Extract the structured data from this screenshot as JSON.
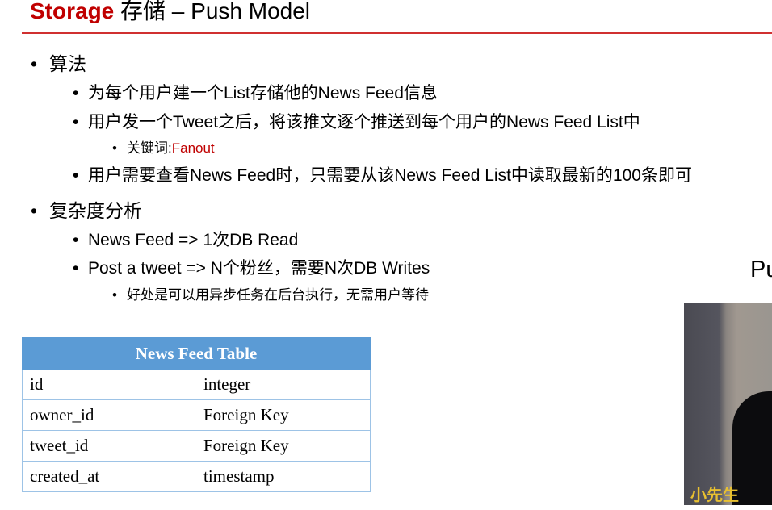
{
  "title": {
    "highlight": "Storage",
    "rest": " 存储 – Push Model"
  },
  "sections": [
    {
      "heading": "算法",
      "items": [
        {
          "text": "为每个用户建一个List存储他的News Feed信息"
        },
        {
          "text": "用户发一个Tweet之后，将该推文逐个推送到每个用户的News Feed List中"
        },
        {
          "sub_label": "关键词:",
          "sub_value": "Fanout"
        },
        {
          "text": "用户需要查看News Feed时，只需要从该News Feed List中读取最新的100条即可"
        }
      ]
    },
    {
      "heading": "复杂度分析",
      "items": [
        {
          "text": "News Feed => 1次DB Read"
        },
        {
          "text": "Post a tweet => N个粉丝，需要N次DB Writes"
        },
        {
          "sub": "好处是可以用异步任务在后台执行，无需用户等待"
        }
      ]
    }
  ],
  "bullet": "•",
  "side_text": "Pu",
  "video_caption": "小先生",
  "table": {
    "title": "News Feed Table",
    "rows": [
      [
        "id",
        "integer"
      ],
      [
        "owner_id",
        "Foreign Key"
      ],
      [
        "tweet_id",
        "Foreign Key"
      ],
      [
        "created_at",
        "timestamp"
      ]
    ]
  }
}
